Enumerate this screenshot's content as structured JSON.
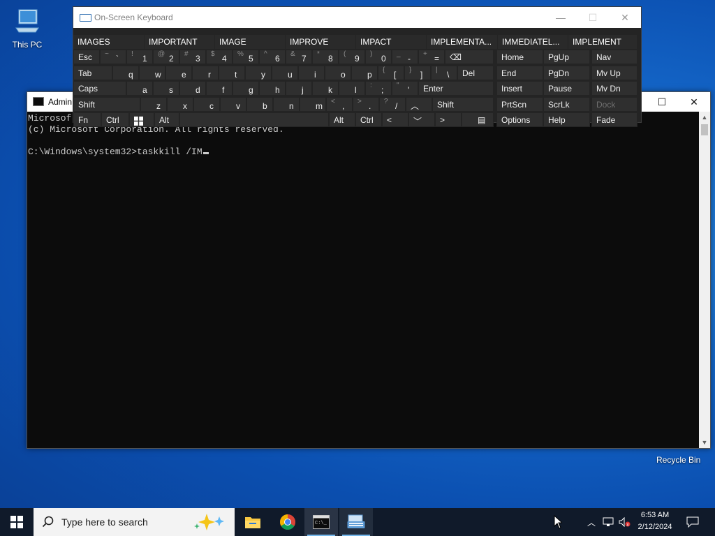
{
  "desktop": {
    "icons": [
      {
        "label": "This PC"
      },
      {
        "label": "Recycle Bin"
      }
    ]
  },
  "console": {
    "title": "Admin",
    "lines": [
      "Microsof",
      "(c) Microsoft Corporation. All rights reserved.",
      "",
      "C:\\Windows\\system32>taskkill /IM"
    ]
  },
  "osk": {
    "title": "On-Screen Keyboard",
    "predictions": [
      "IMAGES",
      "IMPORTANT",
      "IMAGE",
      "IMPROVE",
      "IMPACT",
      "IMPLEMENTA...",
      "IMMEDIATEL...",
      "IMPLEMENT"
    ],
    "keys": {
      "esc": "Esc",
      "tab": "Tab",
      "caps": "Caps",
      "shift": "Shift",
      "fn": "Fn",
      "ctrl": "Ctrl",
      "alt": "Alt",
      "del": "Del",
      "enter": "Enter",
      "shift_r": "Shift",
      "alt_r": "Alt",
      "ctrl_r": "Ctrl",
      "home": "Home",
      "pgup": "PgUp",
      "nav": "Nav",
      "end": "End",
      "pgdn": "PgDn",
      "mvup": "Mv Up",
      "insert": "Insert",
      "pause": "Pause",
      "mvdn": "Mv Dn",
      "prtscn": "PrtScn",
      "scrlk": "ScrLk",
      "dock": "Dock",
      "options": "Options",
      "help": "Help",
      "fade": "Fade",
      "row1": [
        [
          "~",
          "`"
        ],
        [
          "!",
          "1"
        ],
        [
          "@",
          "2"
        ],
        [
          "#",
          "3"
        ],
        [
          "$",
          "4"
        ],
        [
          "%",
          "5"
        ],
        [
          "^",
          "6"
        ],
        [
          "&",
          "7"
        ],
        [
          "*",
          "8"
        ],
        [
          "(",
          "9"
        ],
        [
          ")",
          "0"
        ],
        [
          "_",
          "-"
        ],
        [
          "+",
          "="
        ]
      ],
      "row2": [
        [
          "",
          "q"
        ],
        [
          "",
          "w"
        ],
        [
          "",
          "e"
        ],
        [
          "",
          "r"
        ],
        [
          "",
          "t"
        ],
        [
          "",
          "y"
        ],
        [
          "",
          "u"
        ],
        [
          "",
          "i"
        ],
        [
          "",
          "o"
        ],
        [
          "",
          "p"
        ],
        [
          "{",
          "["
        ],
        [
          "}",
          "]"
        ],
        [
          "|",
          "\\"
        ]
      ],
      "row3": [
        [
          "",
          "a"
        ],
        [
          "",
          "s"
        ],
        [
          "",
          "d"
        ],
        [
          "",
          "f"
        ],
        [
          "",
          "g"
        ],
        [
          "",
          "h"
        ],
        [
          "",
          "j"
        ],
        [
          "",
          "k"
        ],
        [
          "",
          "l"
        ],
        [
          ":",
          ";"
        ],
        [
          "\"",
          "'"
        ]
      ],
      "row4": [
        [
          "",
          "z"
        ],
        [
          "",
          "x"
        ],
        [
          "",
          "c"
        ],
        [
          "",
          "v"
        ],
        [
          "",
          "b"
        ],
        [
          "",
          "n"
        ],
        [
          "",
          "m"
        ],
        [
          "<",
          ","
        ],
        [
          ">",
          "."
        ],
        [
          "?",
          "/"
        ]
      ]
    }
  },
  "taskbar": {
    "search_placeholder": "Type here to search",
    "time": "6:53 AM",
    "date": "2/12/2024"
  }
}
